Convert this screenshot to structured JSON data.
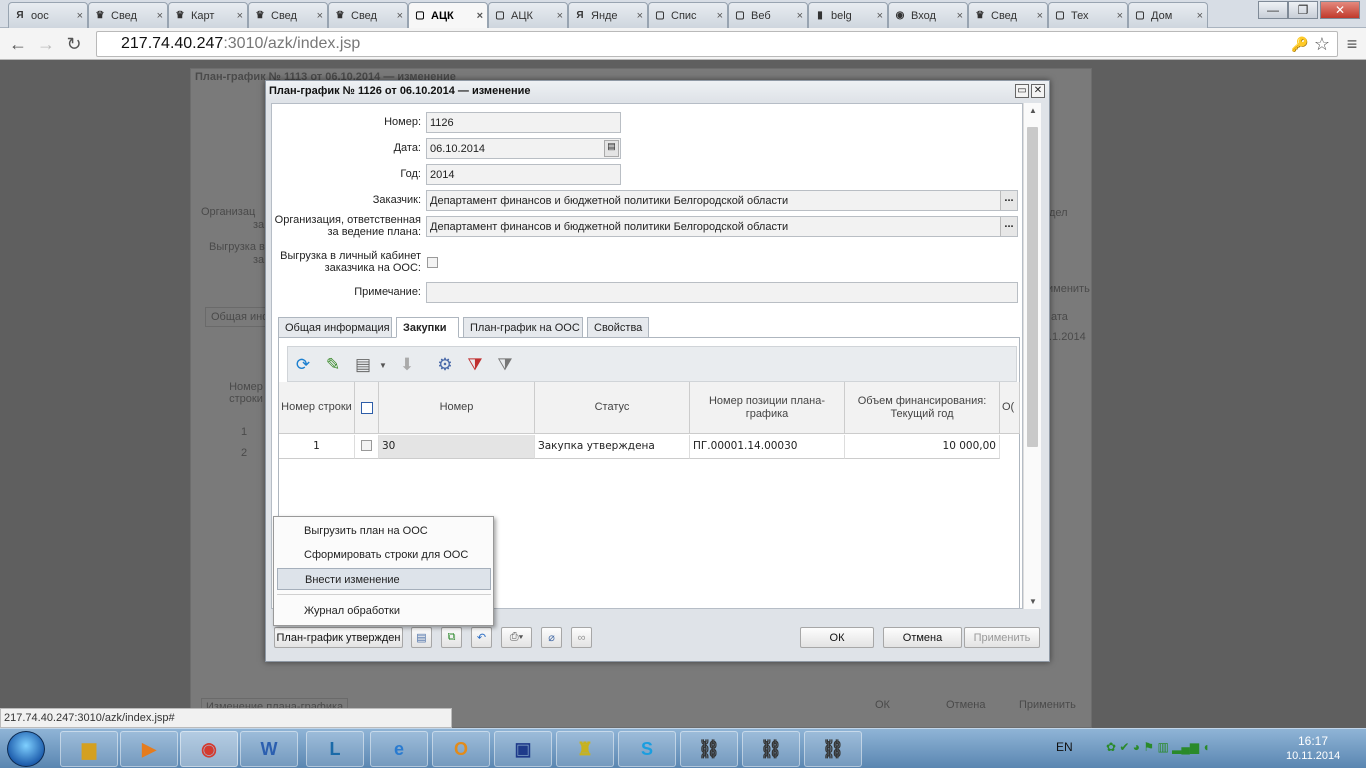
{
  "browser": {
    "tabs": [
      {
        "label": "оос",
        "icon": "Я"
      },
      {
        "label": "Свед",
        "icon": "♛"
      },
      {
        "label": "Карт",
        "icon": "♛"
      },
      {
        "label": "Свед",
        "icon": "♛"
      },
      {
        "label": "Свед",
        "icon": "♛"
      },
      {
        "label": "АЦК",
        "icon": "▢",
        "active": true
      },
      {
        "label": "АЦК",
        "icon": "▢"
      },
      {
        "label": "Янде",
        "icon": "Я"
      },
      {
        "label": "Спис",
        "icon": "▢"
      },
      {
        "label": "Веб",
        "icon": "▢"
      },
      {
        "label": "belg",
        "icon": "▮"
      },
      {
        "label": "Вход",
        "icon": "◉"
      },
      {
        "label": "Свед",
        "icon": "♛"
      },
      {
        "label": "Тех",
        "icon": "▢"
      },
      {
        "label": "Дом",
        "icon": "▢"
      }
    ],
    "tab_close": "×",
    "win_min": "—",
    "win_max": "❐",
    "win_close": "✕",
    "url_host": "217.74.40.247",
    "url_rest": ":3010/azk/index.jsp",
    "back": "←",
    "forward": "→",
    "reload": "↻",
    "key_icon": "🔑",
    "star_icon": "☆",
    "menu_icon": "≡"
  },
  "background_window": {
    "title": "План-график № 1113 от 06.10.2014 — изменение",
    "labels": [
      "Организац",
      "за",
      "Выгрузка в",
      "за"
    ],
    "tab": "Общая инф",
    "grid_header": "Номер строки",
    "rows": [
      "1",
      "2"
    ],
    "right_text": [
      "дел",
      "ата",
      ".1.2014"
    ],
    "apply_small": "именить",
    "bottom_left": "Изменение плана-графика",
    "ok": "ОК",
    "cancel": "Отмена",
    "apply": "Применить"
  },
  "dialog": {
    "title": "План-график № 1126 от 06.10.2014 — изменение",
    "fields": {
      "number_label": "Номер:",
      "number_value": "1126",
      "date_label": "Дата:",
      "date_value": "06.10.2014",
      "year_label": "Год:",
      "year_value": "2014",
      "customer_label": "Заказчик:",
      "customer_value": "Департамент финансов и бюджетной политики Белгородской области",
      "org_label_1": "Организация, ответственная",
      "org_label_2": "за ведение плана:",
      "org_value": "Департамент финансов и бюджетной политики Белгородской области",
      "upload_label_1": "Выгрузка в личный кабинет",
      "upload_label_2": "заказчика на ООС:",
      "note_label": "Примечание:",
      "note_value": "",
      "ellipsis": "..."
    },
    "tabs": [
      "Общая информация",
      "Закупки",
      "План-график на ООС",
      "Свойства"
    ],
    "active_tab": "Закупки",
    "grid": {
      "columns": [
        "Номер строки",
        "",
        "Номер",
        "Статус",
        "Номер позиции плана-графика",
        "Объем финансирования: Текущий год",
        "О("
      ],
      "rows": [
        {
          "row_no": "1",
          "number": "30",
          "status": "Закупка утверждена",
          "position": "ПГ.00001.14.00030",
          "amount": "10 000,00"
        }
      ]
    },
    "context_menu": [
      "Выгрузить план на ООС",
      "Сформировать строки для ООС",
      "Внести изменение",
      "Журнал обработки"
    ],
    "selected_menu_item": "Внести изменение",
    "status_button": "План-график утвержден",
    "ok": "ОК",
    "cancel": "Отмена",
    "apply": "Применить"
  },
  "status_url": "217.74.40.247:3010/azk/index.jsp#",
  "taskbar": {
    "lang": "EN",
    "time": "16:17",
    "date": "10.11.2014"
  }
}
